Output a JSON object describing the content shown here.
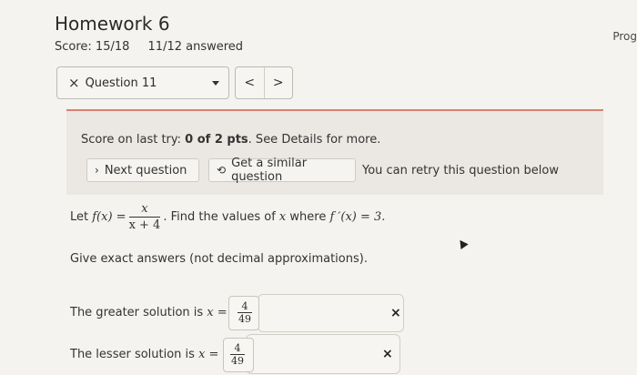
{
  "header": {
    "title": "Homework 6",
    "score": "Score: 15/18",
    "answered": "11/12 answered",
    "progress_label": "Prog"
  },
  "question_nav": {
    "close_glyph": "×",
    "selected_question": "Question 11",
    "prev_glyph": "<",
    "next_glyph": ">"
  },
  "banner": {
    "score_prefix": "Score on last try: ",
    "score_value": "0 of 2 pts",
    "score_suffix": ". See Details for more.",
    "next_question_label": "Next question",
    "similar_question_label": "Get a similar question",
    "retry_text": "You can retry this question below"
  },
  "problem": {
    "lead": "Let",
    "func": "f(x) =",
    "numerator": "x",
    "denominator": "x + 4",
    "task": ". Find the values of",
    "var": "x",
    "where": "where",
    "condition": "f ′(x) = 3.",
    "instructions": "Give exact answers (not decimal approximations)."
  },
  "answers": [
    {
      "label": "The greater solution is",
      "var": "x =",
      "numerator": "4",
      "denominator": "49",
      "status": "×"
    },
    {
      "label": "The lesser solution is",
      "var": "x =",
      "numerator": "4",
      "denominator": "49",
      "status": "×"
    }
  ],
  "colors": {
    "banner_background": "#ebe7e2",
    "banner_accent": "#d9806f",
    "page_background": "#f4f3ef"
  },
  "icons": [
    "close-icon",
    "chevron-down-icon",
    "chevron-left-icon",
    "chevron-right-icon",
    "refresh-icon",
    "incorrect-icon"
  ]
}
